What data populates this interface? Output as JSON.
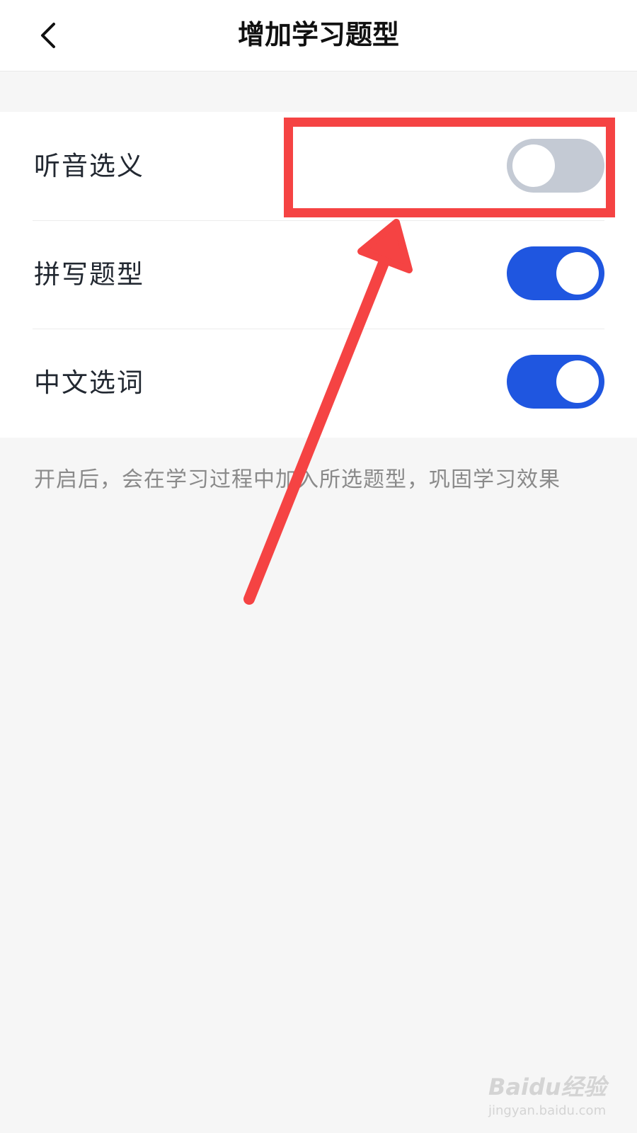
{
  "header": {
    "back_icon": "chevron-left-icon",
    "title": "增加学习题型"
  },
  "settings": [
    {
      "label": "听音选义",
      "enabled": false
    },
    {
      "label": "拼写题型",
      "enabled": true
    },
    {
      "label": "中文选词",
      "enabled": true
    }
  ],
  "hint": "开启后，会在学习过程中加入所选题型，巩固学习效果",
  "colors": {
    "toggle_on": "#1f56e0",
    "toggle_off": "#c4cad4",
    "annotation": "#f54343"
  },
  "watermark": {
    "logo": "Baidu经验",
    "url": "jingyan.baidu.com"
  }
}
